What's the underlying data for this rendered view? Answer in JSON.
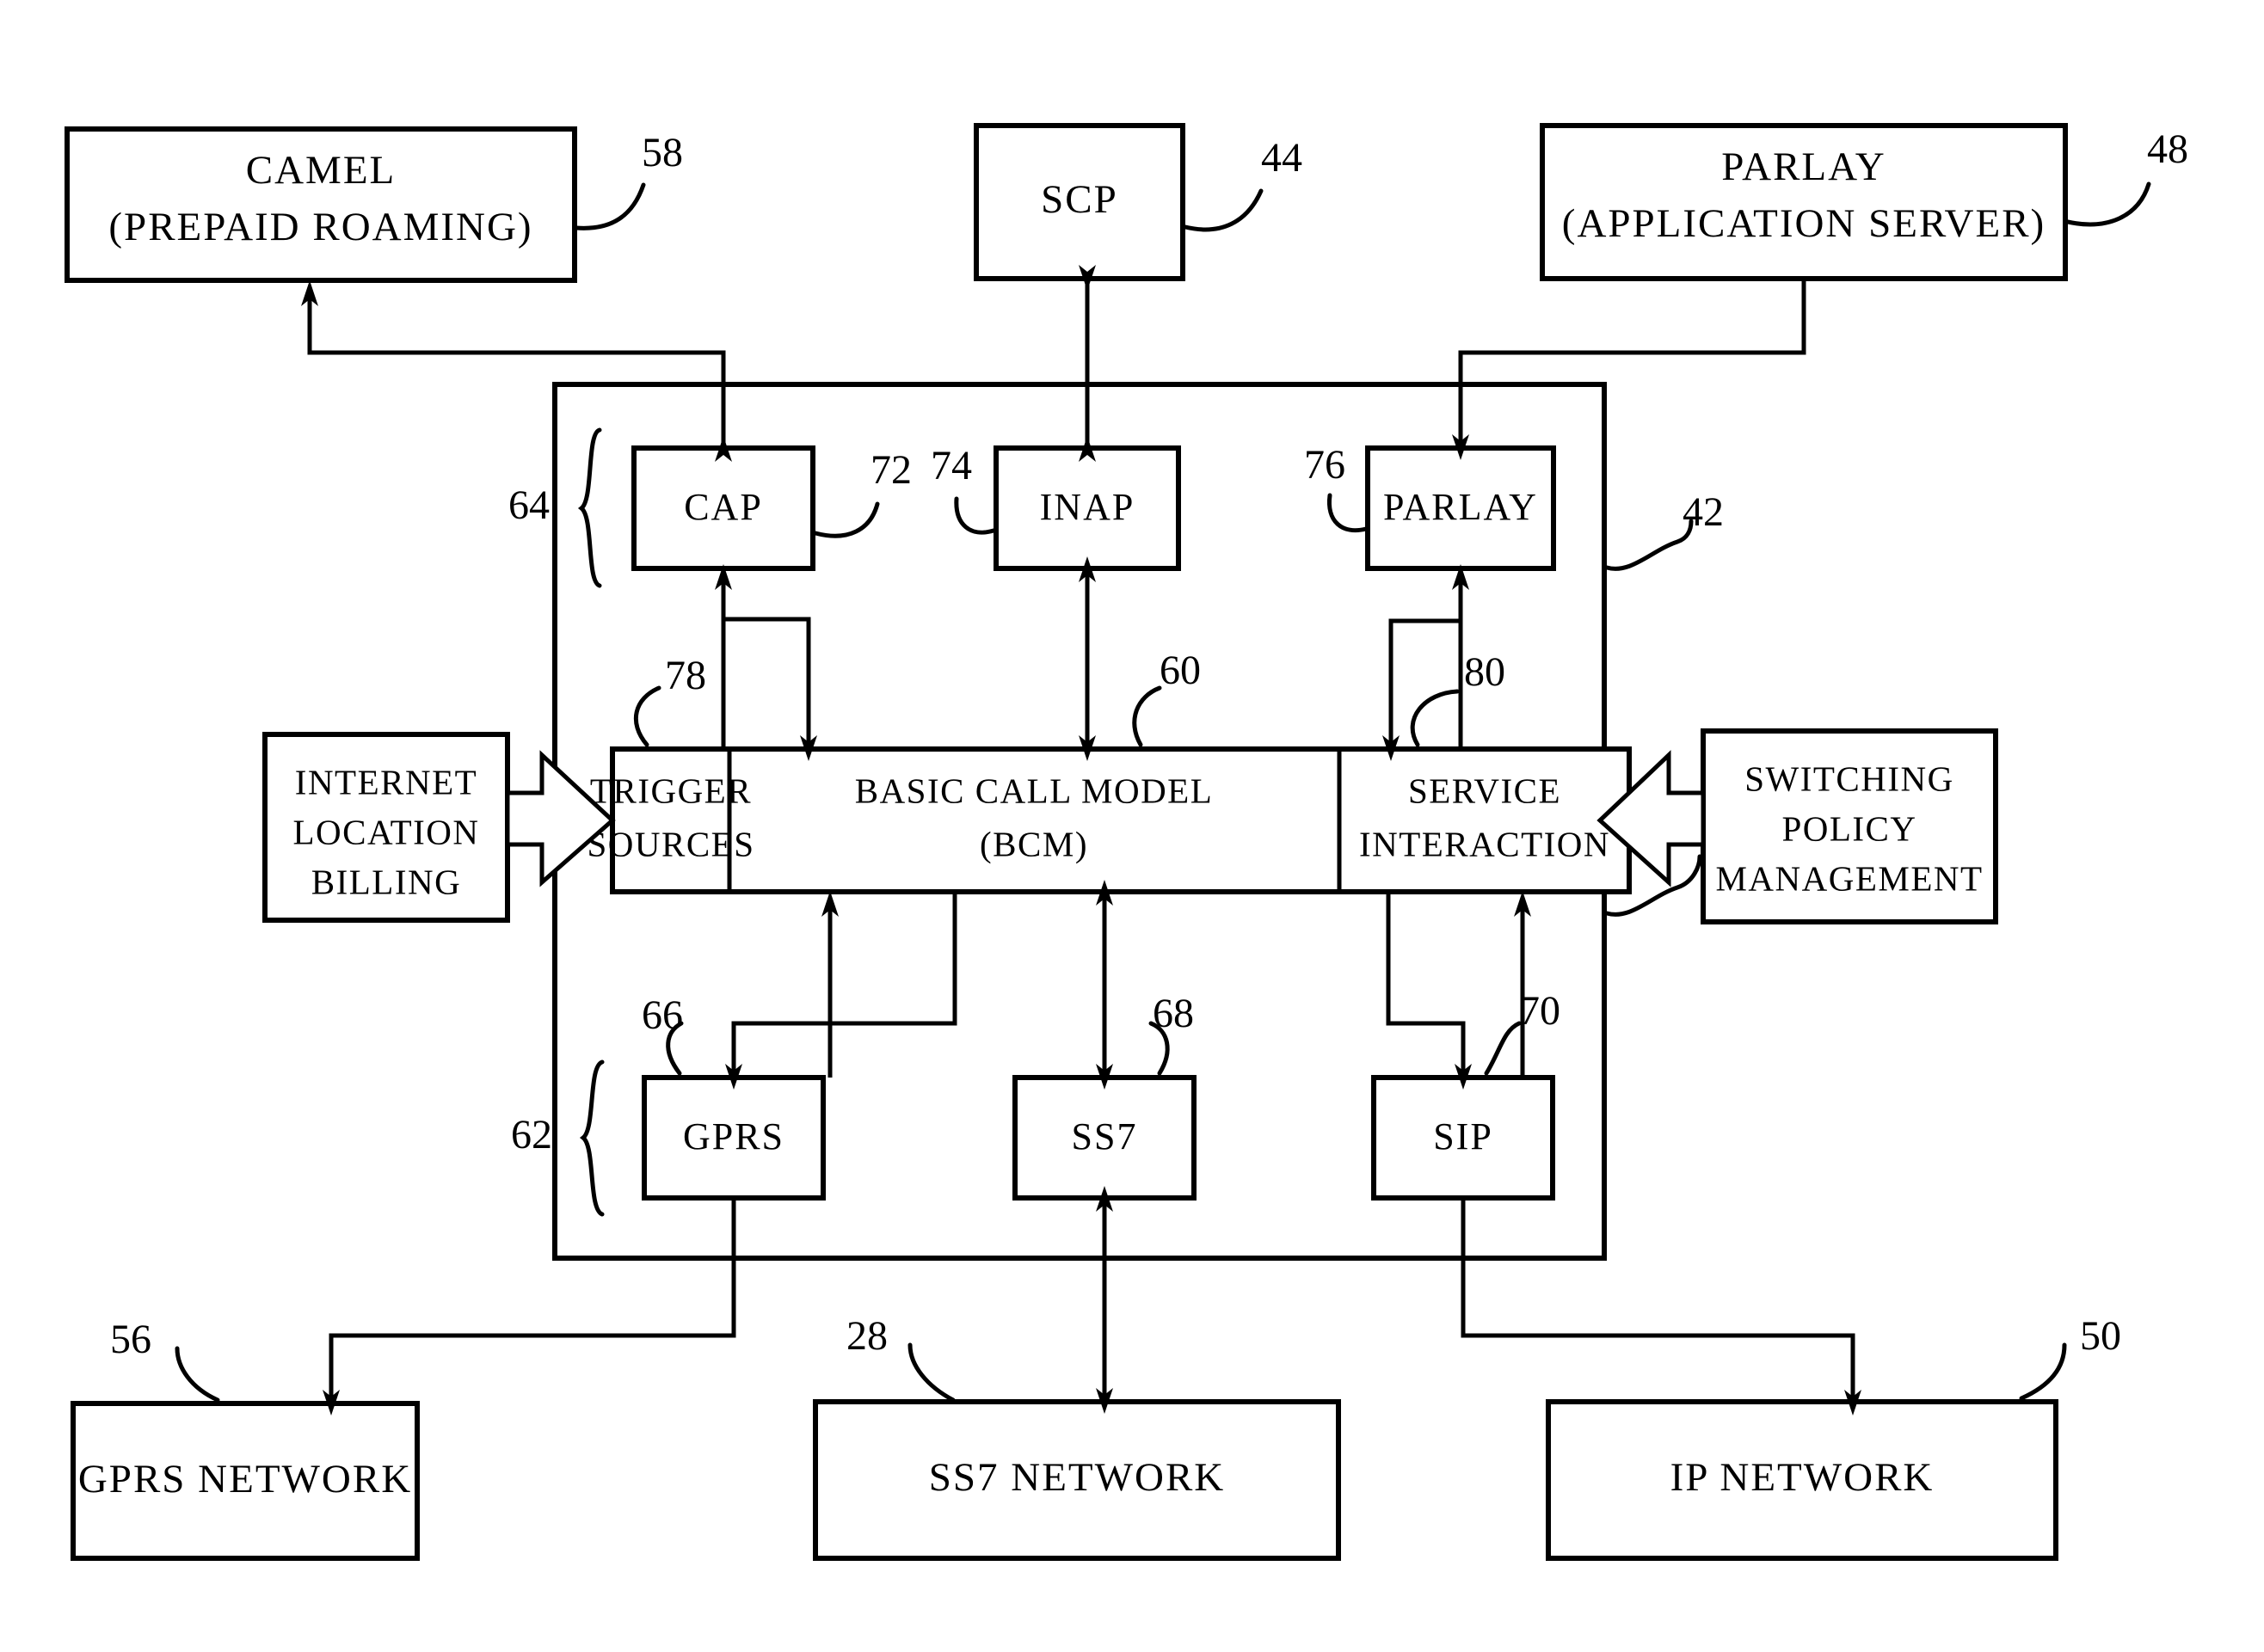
{
  "figure": {
    "type": "patent-block-diagram",
    "background_color": "#ffffff",
    "line_color": "#000000"
  },
  "nodes": {
    "camel": {
      "ref": "58",
      "lines": [
        "CAMEL",
        "(PREPAID ROAMING)"
      ]
    },
    "scp": {
      "ref": "44",
      "lines": [
        "SCP"
      ]
    },
    "parlay_app_server": {
      "ref": "48",
      "lines": [
        "PARLAY",
        "(APPLICATION SERVER)"
      ]
    },
    "cap": {
      "ref": "72",
      "lines": [
        "CAP"
      ]
    },
    "inap": {
      "ref": "74",
      "lines": [
        "INAP"
      ]
    },
    "parlay": {
      "ref": "76",
      "lines": [
        "PARLAY"
      ]
    },
    "trigger_sources": {
      "ref": "78",
      "lines": [
        "TRIGGER",
        "SOURCES"
      ]
    },
    "basic_call_model": {
      "ref": "60",
      "lines": [
        "BASIC  CALL  MODEL",
        "(BCM)"
      ]
    },
    "service_interaction": {
      "ref": "80",
      "lines": [
        "SERVICE",
        "INTERACTION"
      ]
    },
    "internet_location_billing": {
      "ref": "",
      "lines": [
        "INTERNET",
        "LOCATION",
        "BILLING"
      ]
    },
    "switching_policy_management": {
      "ref": "",
      "lines": [
        "SWITCHING",
        "POLICY",
        "MANAGEMENT"
      ]
    },
    "gprs": {
      "ref": "66",
      "lines": [
        "GPRS"
      ]
    },
    "ss7": {
      "ref": "68",
      "lines": [
        "SS7"
      ]
    },
    "sip": {
      "ref": "70",
      "lines": [
        "SIP"
      ]
    },
    "gprs_network": {
      "ref": "56",
      "lines": [
        "GPRS NETWORK"
      ]
    },
    "ss7_network": {
      "ref": "28",
      "lines": [
        "SS7 NETWORK"
      ]
    },
    "ip_network": {
      "ref": "50",
      "lines": [
        "IP NETWORK"
      ]
    }
  },
  "groups": {
    "upper_protocol_group": {
      "ref": "64"
    },
    "lower_protocol_group": {
      "ref": "62"
    },
    "container": {
      "ref": "42"
    }
  }
}
